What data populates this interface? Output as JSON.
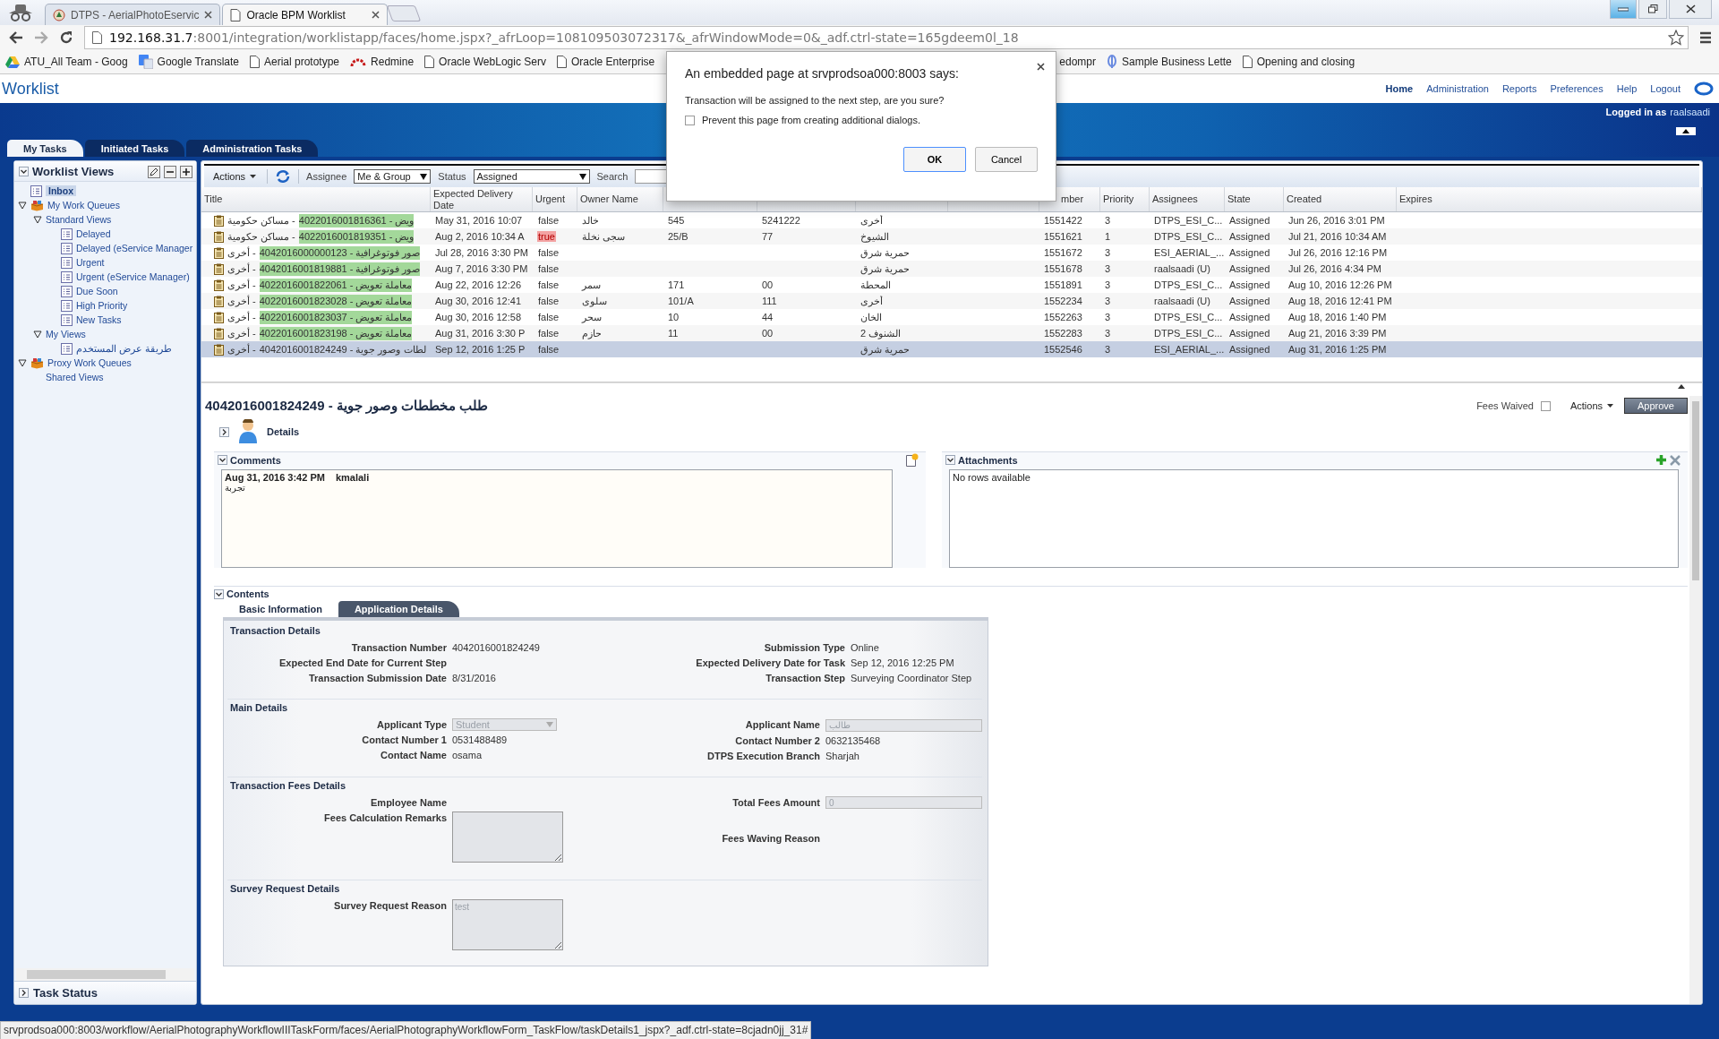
{
  "browser": {
    "tabs": [
      {
        "title": "DTPS - AerialPhotoEservic",
        "selected": false
      },
      {
        "title": "Oracle BPM Worklist",
        "selected": true
      }
    ],
    "address": {
      "host": "192.168.31.7",
      "rest": ":8001/integration/worklistapp/faces/home.jspx?_afrLoop=108109503072317&_afrWindowMode=0&_adf.ctrl-state=165gdeem0l_18"
    },
    "bookmarks": [
      {
        "label": "ATU_All Team - Goog",
        "kind": "drive"
      },
      {
        "label": "Google Translate",
        "kind": "translate"
      },
      {
        "label": "Aerial prototype",
        "kind": "page"
      },
      {
        "label": "Redmine",
        "kind": "redmine"
      },
      {
        "label": "Oracle WebLogic Serv",
        "kind": "page"
      },
      {
        "label": "Oracle Enterprise",
        "kind": "page"
      },
      {
        "label": "edompr",
        "kind": "none"
      },
      {
        "label": "Sample Business Lette",
        "kind": "pin"
      },
      {
        "label": "Opening and closing",
        "kind": "page"
      }
    ],
    "status_text": "srvprodsoa000:8003/workflow/AerialPhotographyWorkflowIIITaskForm/faces/AerialPhotographyWorkflowForm_TaskFlow/taskDetails1_jspx?_adf.ctrl-state=8cjadn0jj_31#"
  },
  "app": {
    "title": "Worklist",
    "nav": [
      {
        "label": "Home",
        "selected": true
      },
      {
        "label": "Administration",
        "selected": false
      },
      {
        "label": "Reports",
        "selected": false
      },
      {
        "label": "Preferences",
        "selected": false
      },
      {
        "label": "Help",
        "selected": false
      },
      {
        "label": "Logout",
        "selected": false
      }
    ],
    "logged_in_label": "Logged in as",
    "user": "raalsaadi",
    "tabs": [
      {
        "label": "My Tasks",
        "selected": true
      },
      {
        "label": "Initiated Tasks",
        "selected": false
      },
      {
        "label": "Administration Tasks",
        "selected": false
      }
    ]
  },
  "sidebar": {
    "title": "Worklist Views",
    "tree": [
      {
        "label": "Inbox",
        "kind": "view",
        "selected": true
      },
      {
        "label": "My Work Queues",
        "kind": "queue",
        "selected": false,
        "expanded": true,
        "children": [
          {
            "label": "Standard Views",
            "kind": "folder",
            "selected": false,
            "expanded": true,
            "children": [
              {
                "label": "Delayed",
                "kind": "view",
                "selected": false
              },
              {
                "label": "Delayed (eService Manager",
                "kind": "view",
                "selected": false
              },
              {
                "label": "Urgent",
                "kind": "view",
                "selected": false
              },
              {
                "label": "Urgent (eService Manager)",
                "kind": "view",
                "selected": false
              },
              {
                "label": "Due Soon",
                "kind": "view",
                "selected": false
              },
              {
                "label": "High Priority",
                "kind": "view",
                "selected": false
              },
              {
                "label": "New Tasks",
                "kind": "view",
                "selected": false
              }
            ]
          },
          {
            "label": "My Views",
            "kind": "folder",
            "selected": false,
            "expanded": true,
            "children": [
              {
                "label": "طريقة عرض المستخدم",
                "kind": "view",
                "selected": false
              }
            ]
          }
        ]
      },
      {
        "label": "Proxy Work Queues",
        "kind": "queue",
        "selected": false,
        "expanded": true,
        "children": [
          {
            "label": "Shared Views",
            "kind": "folder",
            "selected": false
          }
        ]
      }
    ],
    "task_status": {
      "title": "Task Status",
      "expanded": false
    }
  },
  "toolbar": {
    "actions": "Actions",
    "assignee_label": "Assignee",
    "assignee": "Me & Group",
    "status_label": "Status",
    "status": "Assigned",
    "search_label": "Search"
  },
  "table": {
    "columns": [
      "Title",
      "Expected Delivery Date",
      "Urgent",
      "Owner Name",
      "mber",
      "Priority",
      "Assignees",
      "State",
      "Created",
      "Expires"
    ],
    "rows": [
      {
        "title": {
          "plain": "- مساكن حكومية",
          "marked": "ويض - 4022016001816361",
          "highlighted": true
        },
        "expected_delivery_date": "May 31, 2016 10:07",
        "urgent": "false",
        "urgent_highlighted": false,
        "owner_name": "خالد",
        "column_5": "545",
        "column_6": "5241222",
        "column_7": "أخرى",
        "number": "1551422",
        "priority": "3",
        "assignees": "DTPS_ESI_C...",
        "state": "Assigned",
        "created": "Jun 26, 2016 3:01 PM",
        "selected": false
      },
      {
        "title": {
          "plain": "- مساكن حكومية",
          "marked": "ويض - 4022016001819351",
          "highlighted": true
        },
        "expected_delivery_date": "Aug 2, 2016 10:34 A",
        "urgent": "true",
        "urgent_highlighted": true,
        "owner_name": "سجى نخلة",
        "column_5": "25/B",
        "column_6": "77",
        "column_7": "الشيوخ",
        "number": "1551621",
        "priority": "1",
        "assignees": "DTPS_ESI_C...",
        "state": "Assigned",
        "created": "Jul 21, 2016 10:34 AM",
        "selected": false
      },
      {
        "title": {
          "plain": "- أخرى",
          "marked": "صور فوتوغرافية - 4042016000000123",
          "highlighted": true
        },
        "expected_delivery_date": "Jul 28, 2016 3:30 PM",
        "urgent": "false",
        "urgent_highlighted": false,
        "column_7": "حمرية شرق",
        "number": "1551672",
        "priority": "3",
        "assignees": "ESI_AERIAL_...",
        "state": "Assigned",
        "created": "Jul 26, 2016 12:16 PM",
        "selected": false
      },
      {
        "title": {
          "plain": "- أخرى",
          "marked": "صور فوتوغرافية - 4042016001819881",
          "highlighted": true
        },
        "expected_delivery_date": "Aug 7, 2016 3:30 PM",
        "urgent": "false",
        "urgent_highlighted": false,
        "column_7": "حمرية شرق",
        "number": "1551678",
        "priority": "3",
        "assignees": "raalsaadi (U)",
        "state": "Assigned",
        "created": "Jul 26, 2016 4:34 PM",
        "selected": false
      },
      {
        "title": {
          "plain": "- أخرى",
          "marked": "معاملة تعويض - 4022016001822061",
          "highlighted": true
        },
        "expected_delivery_date": "Aug 22, 2016 12:26",
        "urgent": "false",
        "urgent_highlighted": false,
        "owner_name": "سمر",
        "column_5": "171",
        "column_6": "00",
        "column_7": "المحطة",
        "number": "1551891",
        "priority": "3",
        "assignees": "DTPS_ESI_C...",
        "state": "Assigned",
        "created": "Aug 10, 2016 12:26 PM",
        "selected": false
      },
      {
        "title": {
          "plain": "- أخرى",
          "marked": "معاملة تعويض - 4022016001823028",
          "highlighted": true
        },
        "expected_delivery_date": "Aug 30, 2016 12:41",
        "urgent": "false",
        "urgent_highlighted": false,
        "owner_name": "سلوى",
        "column_5": "101/A",
        "column_6": "111",
        "column_7": "أخرى",
        "number": "1552234",
        "priority": "3",
        "assignees": "raalsaadi (U)",
        "state": "Assigned",
        "created": "Aug 18, 2016 12:41 PM",
        "selected": false
      },
      {
        "title": {
          "plain": "- أخرى",
          "marked": "معاملة تعويض - 4022016001823037",
          "highlighted": true
        },
        "expected_delivery_date": "Aug 30, 2016 12:58",
        "urgent": "false",
        "urgent_highlighted": false,
        "owner_name": "سحر",
        "column_5": "10",
        "column_6": "44",
        "column_7": "الخان",
        "number": "1552263",
        "priority": "3",
        "assignees": "DTPS_ESI_C...",
        "state": "Assigned",
        "created": "Aug 18, 2016 1:40 PM",
        "selected": false
      },
      {
        "title": {
          "plain": "- أخرى",
          "marked": "معاملة تعويض - 4022016001823198",
          "highlighted": true
        },
        "expected_delivery_date": "Aug 31, 2016 3:30 P",
        "urgent": "false",
        "urgent_highlighted": false,
        "owner_name": "حازم",
        "column_5": "11",
        "column_6": "00",
        "column_7": "الشنوف 2",
        "number": "1552283",
        "priority": "3",
        "assignees": "DTPS_ESI_C...",
        "state": "Assigned",
        "created": "Aug 21, 2016 3:39 PM",
        "selected": false
      },
      {
        "title": {
          "plain": "- أخرى",
          "marked": "لطات وصور جوية - 4042016001824249",
          "highlighted": false
        },
        "expected_delivery_date": "Sep 12, 2016 1:25 P",
        "urgent": "false",
        "urgent_highlighted": false,
        "column_7": "حمرية شرق",
        "number": "1552546",
        "priority": "3",
        "assignees": "ESI_AERIAL_...",
        "state": "Assigned",
        "created": "Aug 31, 2016 1:25 PM",
        "selected": true
      }
    ]
  },
  "detail": {
    "title": "طلب مخططات وصور جوية - 4042016001824249",
    "fees_waived": {
      "label": "Fees Waived",
      "checked": false
    },
    "actions": "Actions",
    "approve": "Approve",
    "details": {
      "label": "Details",
      "expanded": false
    },
    "comments": {
      "title": "Comments",
      "expanded": true,
      "entries": [
        {
          "date": "Aug 31, 2016 3:42 PM",
          "author": "kmalali",
          "text": "تجربة"
        }
      ]
    },
    "attachments": {
      "title": "Attachments",
      "expanded": true,
      "empty_text": "No rows available"
    },
    "contents": {
      "title": "Contents",
      "expanded": true,
      "tabs": [
        {
          "label": "Basic Information",
          "selected": true
        },
        {
          "label": "Application Details",
          "selected": false
        }
      ],
      "sections": [
        {
          "title": "Transaction Details",
          "left": [
            {
              "label": "Transaction Number",
              "kind": "text",
              "value": "4042016001824249"
            },
            {
              "label": "Expected End Date for Current Step",
              "kind": "text"
            },
            {
              "label": "Transaction Submission Date",
              "kind": "text",
              "value": "8/31/2016"
            }
          ],
          "right": [
            {
              "label": "Submission Type",
              "kind": "text",
              "value": "Online"
            },
            {
              "label": "Expected Delivery Date for Task",
              "kind": "text",
              "value": "Sep 12, 2016 12:25 PM"
            },
            {
              "label": "Transaction Step",
              "kind": "text",
              "value": "Surveying Coordinator Step"
            }
          ]
        },
        {
          "title": "Main Details",
          "left": [
            {
              "label": "Applicant Type",
              "kind": "select",
              "value": "Student",
              "disabled": true
            },
            {
              "label": "Contact Number 1",
              "kind": "text",
              "value": "0531488489"
            },
            {
              "label": "Contact Name",
              "kind": "text",
              "value": "osama"
            }
          ],
          "right": [
            {
              "label": "Applicant Name",
              "kind": "input",
              "value": "طالب",
              "disabled": true
            },
            {
              "label": "Contact Number 2",
              "kind": "text",
              "value": "0632135468"
            },
            {
              "label": "DTPS Execution Branch",
              "kind": "text",
              "value": "Sharjah"
            }
          ]
        },
        {
          "title": "Transaction Fees Details",
          "left": [
            {
              "label": "Employee Name",
              "kind": "text"
            },
            {
              "label": "Fees Calculation Remarks",
              "kind": "textarea",
              "disabled": true
            }
          ],
          "right": [
            {
              "label": "Total Fees Amount",
              "kind": "input",
              "value": "0",
              "disabled": true
            },
            {
              "label": "Fees Waving Reason",
              "kind": "text"
            }
          ]
        },
        {
          "title": "Survey Request Details",
          "left": [
            {
              "label": "Survey Request Reason",
              "kind": "textarea",
              "value": "test",
              "disabled": true
            }
          ]
        }
      ]
    }
  },
  "dialog": {
    "title": "An embedded page at srvprodsoa000:8003 says:",
    "message": "Transaction will be assigned to the next step, are you sure?",
    "checkbox": {
      "label": "Prevent this page from creating additional dialogs.",
      "checked": false
    },
    "ok": "OK",
    "cancel": "Cancel"
  }
}
